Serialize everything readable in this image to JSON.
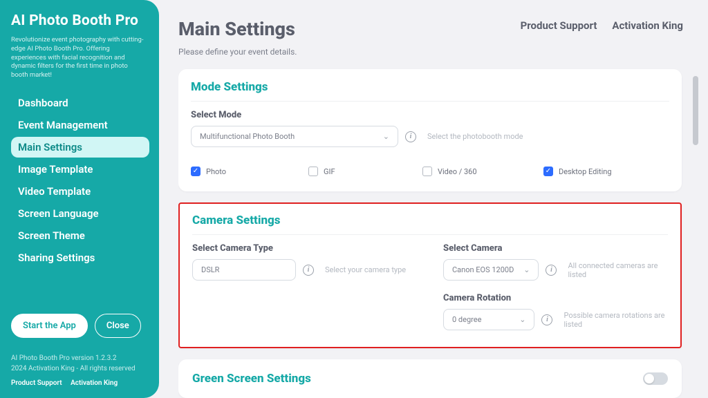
{
  "sidebar": {
    "brand": "AI Photo Booth Pro",
    "tagline": "Revolutionize event photography with cutting-edge AI Photo Booth Pro. Offering experiences with facial recognition and dynamic filters for the first time in photo booth market!",
    "nav": [
      {
        "label": "Dashboard"
      },
      {
        "label": "Event Management"
      },
      {
        "label": "Main Settings"
      },
      {
        "label": "Image Template"
      },
      {
        "label": "Video Template"
      },
      {
        "label": "Screen Language"
      },
      {
        "label": "Screen Theme"
      },
      {
        "label": "Sharing Settings"
      }
    ],
    "buttons": {
      "start": "Start the App",
      "close": "Close"
    },
    "footer": {
      "line1": "AI Photo Booth Pro version 1.2.3.2",
      "line2": "2024 Activation King - All rights reserved",
      "link1": "Product Support",
      "link2": "Activation King"
    }
  },
  "header": {
    "title": "Main Settings",
    "subtitle": "Please define your event details.",
    "links": {
      "support": "Product Support",
      "activation": "Activation King"
    }
  },
  "mode": {
    "title": "Mode Settings",
    "select_label": "Select Mode",
    "select_value": "Multifunctional Photo Booth",
    "hint": "Select the photobooth mode",
    "options": [
      {
        "label": "Photo",
        "checked": true
      },
      {
        "label": "GIF",
        "checked": false
      },
      {
        "label": "Video / 360",
        "checked": false
      },
      {
        "label": "Desktop Editing",
        "checked": true
      }
    ]
  },
  "camera": {
    "title": "Camera Settings",
    "type_label": "Select Camera Type",
    "type_value": "DSLR",
    "type_hint": "Select your camera type",
    "cam_label": "Select Camera",
    "cam_value": "Canon EOS 1200D",
    "cam_hint": "All connected cameras are listed",
    "rot_label": "Camera Rotation",
    "rot_value": "0 degree",
    "rot_hint": "Possible camera rotations are listed"
  },
  "green": {
    "title": "Green Screen Settings"
  }
}
